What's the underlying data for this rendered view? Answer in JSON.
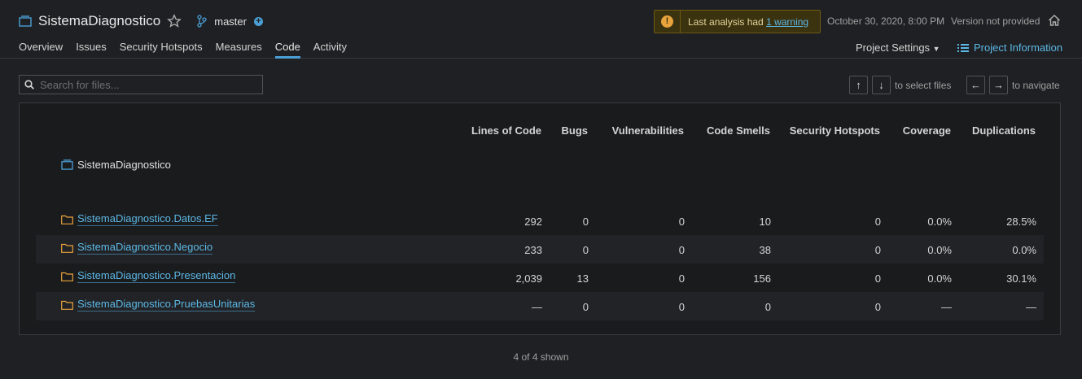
{
  "project": {
    "name": "SistemaDiagnostico",
    "branch": "master"
  },
  "warning": {
    "text": "Last analysis had ",
    "link": "1 warning"
  },
  "analysis_date": "October 30, 2020, 8:00 PM",
  "version": "Version not provided",
  "nav": [
    "Overview",
    "Issues",
    "Security Hotspots",
    "Measures",
    "Code",
    "Activity"
  ],
  "nav_active": "Code",
  "project_settings": "Project Settings",
  "project_information": "Project Information",
  "search": {
    "placeholder": "Search for files..."
  },
  "hints": {
    "select": "to select files",
    "navigate": "to navigate",
    "up": "↑",
    "down": "↓",
    "left": "←",
    "right": "→"
  },
  "table": {
    "columns": [
      "Lines of Code",
      "Bugs",
      "Vulnerabilities",
      "Code Smells",
      "Security Hotspots",
      "Coverage",
      "Duplications"
    ],
    "root": "SistemaDiagnostico",
    "rows": [
      {
        "name": "SistemaDiagnostico.Datos.EF",
        "values": [
          "292",
          "0",
          "0",
          "10",
          "0",
          "0.0%",
          "28.5%"
        ]
      },
      {
        "name": "SistemaDiagnostico.Negocio",
        "values": [
          "233",
          "0",
          "0",
          "38",
          "0",
          "0.0%",
          "0.0%"
        ]
      },
      {
        "name": "SistemaDiagnostico.Presentacion",
        "values": [
          "2,039",
          "13",
          "0",
          "156",
          "0",
          "0.0%",
          "30.1%"
        ]
      },
      {
        "name": "SistemaDiagnostico.PruebasUnitarias",
        "values": [
          "—",
          "0",
          "0",
          "0",
          "0",
          "—",
          "—"
        ]
      }
    ]
  },
  "shown": "4 of 4 shown",
  "colors": {
    "accent": "#4b9fd5",
    "link": "#5cb8e6",
    "warning": "#e8a33d",
    "folder": "#e8a33d"
  },
  "icons": {
    "project": "project-icon",
    "star": "star-icon",
    "branch": "branch-icon",
    "info": "info-icon",
    "home": "home-icon",
    "list": "list-icon",
    "search": "search-icon",
    "folder": "folder-icon"
  }
}
